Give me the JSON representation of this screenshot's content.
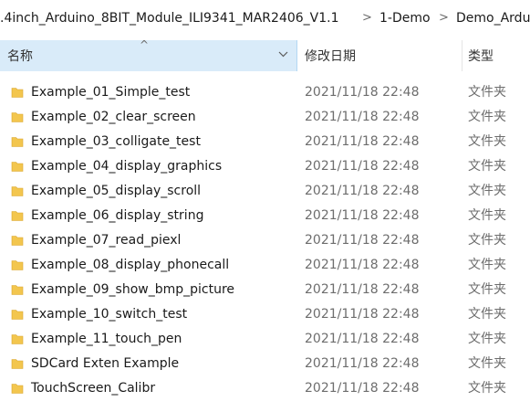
{
  "breadcrumb": {
    "items": [
      ".4inch_Arduino_8BIT_Module_ILI9341_MAR2406_V1.1",
      "1-Demo",
      "Demo_Ardu"
    ],
    "separator": ">"
  },
  "columns": {
    "name": "名称",
    "date": "修改日期",
    "type": "类型"
  },
  "icons": {
    "folder": "folder-icon",
    "sort": "sort-up-icon",
    "dropdown": "chevron-down-icon"
  },
  "colors": {
    "header_selected": "#d9ebf9",
    "folder": "#f3c64e"
  },
  "files": [
    {
      "name": "Example_01_Simple_test",
      "date": "2021/11/18 22:48",
      "type": "文件夹"
    },
    {
      "name": "Example_02_clear_screen",
      "date": "2021/11/18 22:48",
      "type": "文件夹"
    },
    {
      "name": "Example_03_colligate_test",
      "date": "2021/11/18 22:48",
      "type": "文件夹"
    },
    {
      "name": "Example_04_display_graphics",
      "date": "2021/11/18 22:48",
      "type": "文件夹"
    },
    {
      "name": "Example_05_display_scroll",
      "date": "2021/11/18 22:48",
      "type": "文件夹"
    },
    {
      "name": "Example_06_display_string",
      "date": "2021/11/18 22:48",
      "type": "文件夹"
    },
    {
      "name": "Example_07_read_piexl",
      "date": "2021/11/18 22:48",
      "type": "文件夹"
    },
    {
      "name": "Example_08_display_phonecall",
      "date": "2021/11/18 22:48",
      "type": "文件夹"
    },
    {
      "name": "Example_09_show_bmp_picture",
      "date": "2021/11/18 22:48",
      "type": "文件夹"
    },
    {
      "name": "Example_10_switch_test",
      "date": "2021/11/18 22:48",
      "type": "文件夹"
    },
    {
      "name": "Example_11_touch_pen",
      "date": "2021/11/18 22:48",
      "type": "文件夹"
    },
    {
      "name": "SDCard Exten Example",
      "date": "2021/11/18 22:48",
      "type": "文件夹"
    },
    {
      "name": "TouchScreen_Calibr",
      "date": "2021/11/18 22:48",
      "type": "文件夹"
    }
  ]
}
